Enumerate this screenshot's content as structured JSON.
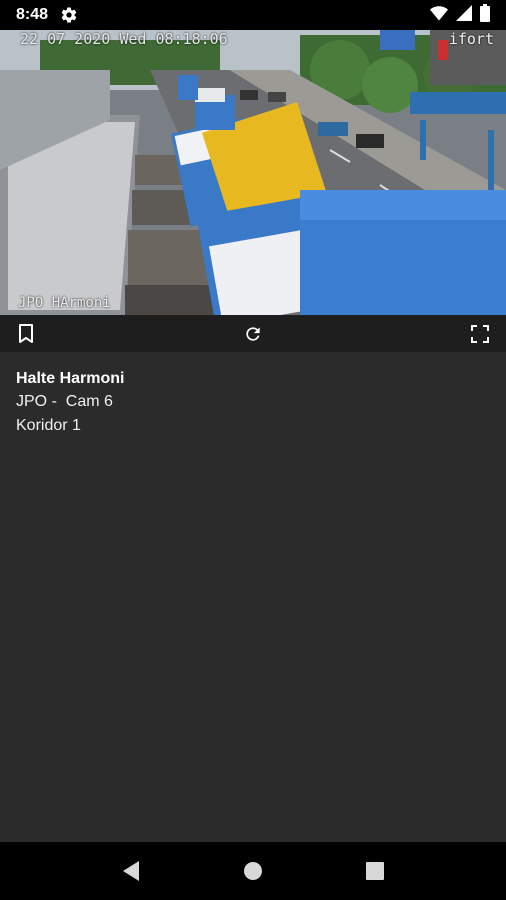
{
  "status_bar": {
    "time": "8:48",
    "icons": [
      "gear-icon",
      "wifi-icon",
      "signal-icon",
      "battery-icon"
    ]
  },
  "camera": {
    "timestamp": "22 07 2020 Wed 08:18:06",
    "brand": "ifort",
    "location_label": "JPO HArmoni"
  },
  "toolbar": {
    "icons": [
      "bookmark-icon",
      "refresh-icon",
      "fullscreen-icon"
    ]
  },
  "info": {
    "title": "Halte Harmoni",
    "camera_name": "JPO -  Cam 6",
    "corridor": "Koridor 1"
  },
  "nav_bar": {
    "icons": [
      "back-icon",
      "home-icon",
      "recents-icon"
    ]
  },
  "colors": {
    "background": "#2b2b2b",
    "toolbar": "#1e1e1e",
    "bus_blue": "#3a78c8",
    "bus_yellow": "#e8b820"
  }
}
